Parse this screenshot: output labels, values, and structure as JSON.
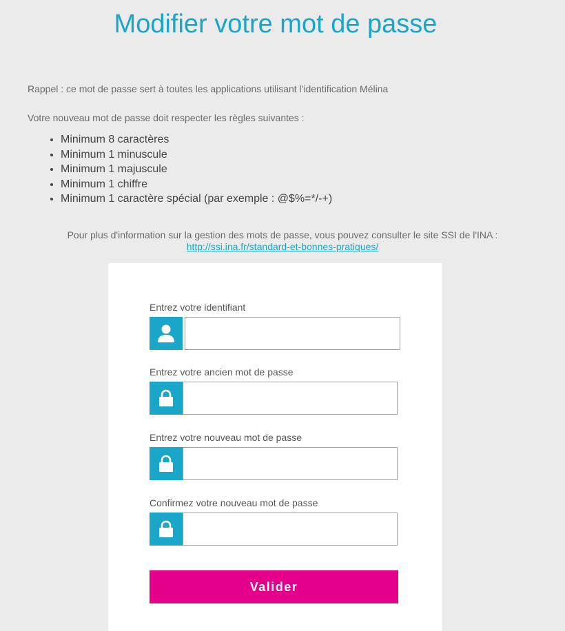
{
  "page": {
    "title": "Modifier votre mot de passe",
    "reminder": "Rappel : ce mot de passe sert à toutes les applications utilisant l'identification Mélina",
    "rules_intro": "Votre nouveau mot de passe doit respecter les règles suivantes :",
    "rules": [
      "Minimum 8 caractères",
      "Minimum 1 minuscule",
      "Minimum 1 majuscule",
      "Minimum 1 chiffre",
      "Minimum 1 caractère spécial (par exemple : @$%=*/-+)"
    ],
    "info_text": "Pour plus d'information sur la gestion des mots de passe, vous pouvez consulter le site SSI de l'INA : ",
    "info_link": "http://ssi.ina.fr/standard-et-bonnes-pratiques/"
  },
  "form": {
    "fields": [
      {
        "label": "Entrez votre identifiant",
        "icon": "user-icon",
        "value": ""
      },
      {
        "label": "Entrez votre ancien mot de passe",
        "icon": "lock-icon",
        "value": ""
      },
      {
        "label": "Entrez votre nouveau mot de passe",
        "icon": "lock-icon",
        "value": ""
      },
      {
        "label": "Confirmez votre nouveau mot de passe",
        "icon": "lock-icon",
        "value": ""
      }
    ],
    "submit_label": "Valider"
  },
  "colors": {
    "accent": "#19a6c9",
    "button": "#e5008c",
    "background": "#ebebeb"
  }
}
